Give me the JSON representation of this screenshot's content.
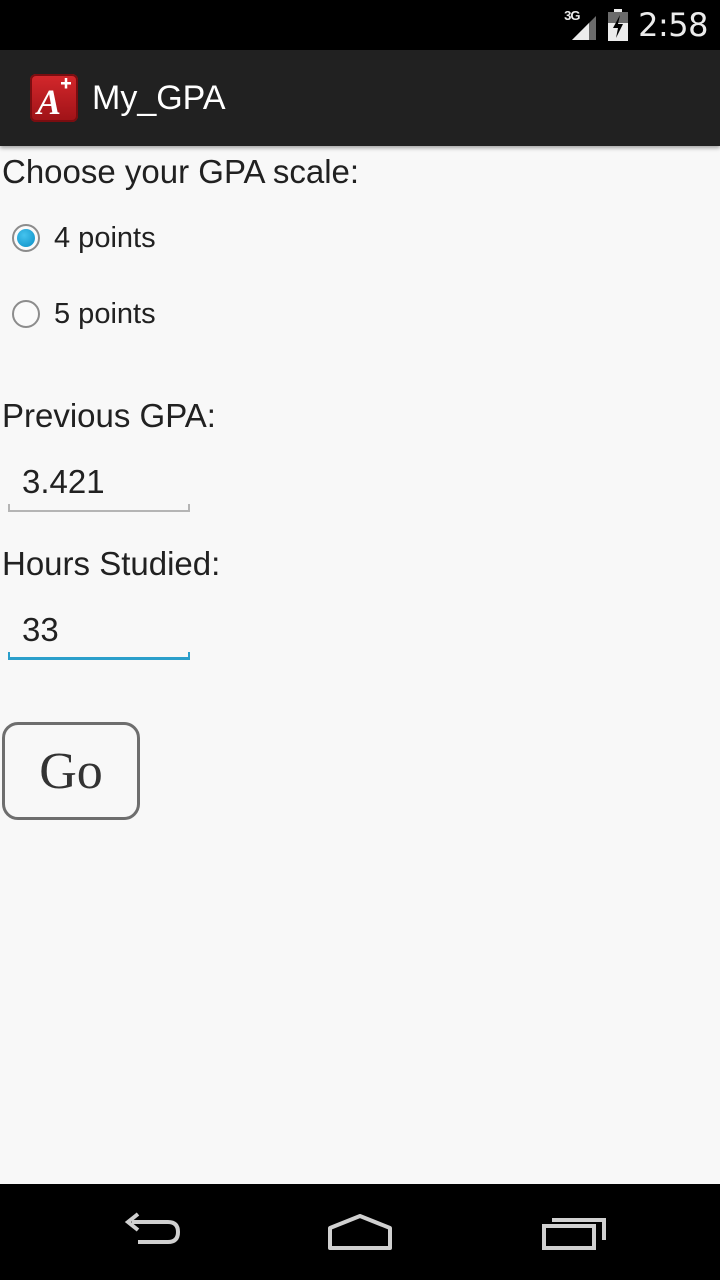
{
  "status_bar": {
    "network_type": "3G",
    "time": "2:58",
    "icons": [
      "signal-icon",
      "battery-charging-icon"
    ]
  },
  "action_bar": {
    "app_icon": "a-plus-app-icon",
    "title": "My_GPA"
  },
  "form": {
    "scale_label": "Choose your GPA scale:",
    "scale_options": [
      {
        "label": "4 points",
        "checked": true
      },
      {
        "label": "5 points",
        "checked": false
      }
    ],
    "previous_gpa_label": "Previous GPA:",
    "previous_gpa_value": "3.421",
    "hours_label": "Hours Studied:",
    "hours_value": "33",
    "go_label": "Go"
  },
  "nav_bar": {
    "icons": [
      "back-icon",
      "home-icon",
      "recent-apps-icon"
    ]
  },
  "colors": {
    "accent": "#0a8fc6",
    "focus_underline": "#2b9fcb",
    "app_icon_red": "#d5282c"
  }
}
